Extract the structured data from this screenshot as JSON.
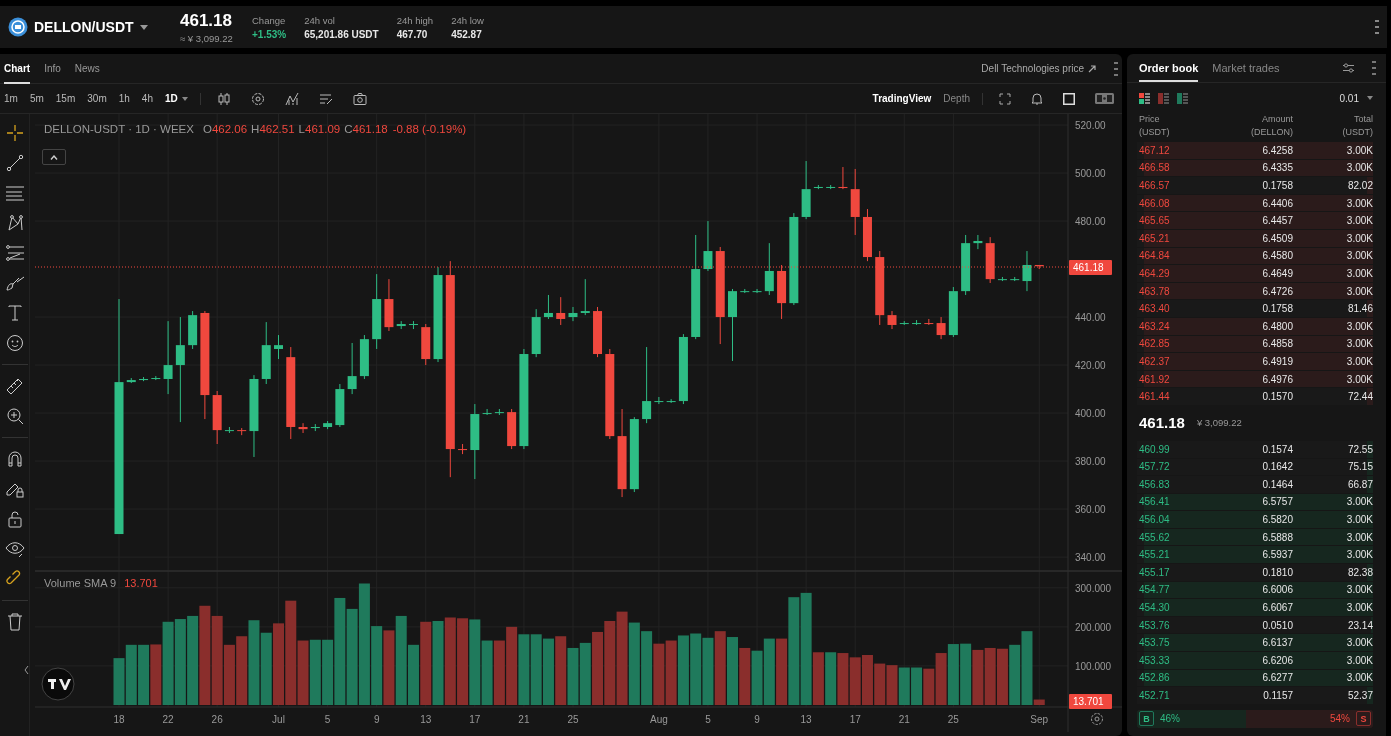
{
  "header": {
    "pair": "DELLON/USDT",
    "price": "461.18",
    "price_converted": "≈ ¥ 3,099.22",
    "stats": [
      {
        "label": "Change",
        "value": "+1.53%",
        "color": "#2ebd85"
      },
      {
        "label": "24h vol",
        "value": "65,201.86 USDT",
        "color": "#e8e8e8"
      },
      {
        "label": "24h high",
        "value": "467.70",
        "color": "#e8e8e8"
      },
      {
        "label": "24h low",
        "value": "452.87",
        "color": "#e8e8e8"
      }
    ]
  },
  "chart_tabs": [
    {
      "label": "Chart",
      "selected": true
    },
    {
      "label": "Info",
      "selected": false
    },
    {
      "label": "News",
      "selected": false
    }
  ],
  "external_link": "Dell Technologies price",
  "intervals": [
    {
      "label": "1m",
      "selected": false
    },
    {
      "label": "5m",
      "selected": false
    },
    {
      "label": "15m",
      "selected": false
    },
    {
      "label": "30m",
      "selected": false
    },
    {
      "label": "1h",
      "selected": false
    },
    {
      "label": "4h",
      "selected": false
    },
    {
      "label": "1D",
      "selected": true
    }
  ],
  "views": [
    {
      "label": "TradingView",
      "selected": true
    },
    {
      "label": "Depth",
      "selected": false
    }
  ],
  "legend": {
    "symbol": "DELLON-USDT · 1D · WEEX",
    "ohlc": [
      {
        "key": "O",
        "value": "462.06"
      },
      {
        "key": "H",
        "value": "462.51"
      },
      {
        "key": "L",
        "value": "461.09"
      },
      {
        "key": "C",
        "value": "461.18"
      }
    ],
    "change": "-0.88 (-0.19%)"
  },
  "price_chart": {
    "last_price_tag": "461.18",
    "chart_data": {
      "type": "candlestick",
      "grid": true,
      "ylim": [
        334.2,
        524.6
      ],
      "yticks": [
        {
          "value": 520,
          "label": "520.00"
        },
        {
          "value": 500,
          "label": "500.00"
        },
        {
          "value": 480,
          "label": "480.00"
        },
        {
          "value": 440,
          "label": "440.00"
        },
        {
          "value": 420,
          "label": "420.00"
        },
        {
          "value": 400,
          "label": "400.00"
        },
        {
          "value": 380,
          "label": "380.00"
        },
        {
          "value": 360,
          "label": "360.00"
        },
        {
          "value": 340,
          "label": "340.00"
        }
      ],
      "ohlc": [
        [
          349.6,
          447.5,
          349.6,
          412.9
        ],
        [
          412.9,
          414.6,
          412.5,
          413.75
        ],
        [
          413.75,
          415,
          413.3,
          414.2
        ],
        [
          414.2,
          415.4,
          413.75,
          414.6
        ],
        [
          414.2,
          438.3,
          407.9,
          420
        ],
        [
          420,
          440,
          396.25,
          428.3
        ],
        [
          428.3,
          442.5,
          426.7,
          440.8
        ],
        [
          441.7,
          442.5,
          397.5,
          407.5
        ],
        [
          407.5,
          409.2,
          387.1,
          392.9
        ],
        [
          392.9,
          394.2,
          391.7,
          392.9
        ],
        [
          392.9,
          393.75,
          390.8,
          392.5
        ],
        [
          392.5,
          415.8,
          381.7,
          414.2
        ],
        [
          414.2,
          437.9,
          412.1,
          428.3
        ],
        [
          426.7,
          432.5,
          422.5,
          428.3
        ],
        [
          423.3,
          427.5,
          389.2,
          394.2
        ],
        [
          394.2,
          395.8,
          391.7,
          393.3
        ],
        [
          393.75,
          395.4,
          392.5,
          394.2
        ],
        [
          394.2,
          396.7,
          393.3,
          395.8
        ],
        [
          395,
          412.1,
          394.2,
          410
        ],
        [
          410,
          429.2,
          407.9,
          415.4
        ],
        [
          415.4,
          432.5,
          414.2,
          430.8
        ],
        [
          430.8,
          457.9,
          426.7,
          447.5
        ],
        [
          447.5,
          455.8,
          434.2,
          435.8
        ],
        [
          436.25,
          438.3,
          435,
          437.1
        ],
        [
          436.7,
          438.3,
          435,
          437.1
        ],
        [
          435.8,
          437.1,
          420,
          422.5
        ],
        [
          422.5,
          460.8,
          421.25,
          457.5
        ],
        [
          457.5,
          463.3,
          373.3,
          385
        ],
        [
          385,
          387.1,
          382.9,
          384.6
        ],
        [
          384.6,
          403.75,
          372.5,
          399.6
        ],
        [
          400,
          401.7,
          399.2,
          400
        ],
        [
          400.4,
          401.7,
          399.2,
          400.4
        ],
        [
          400.4,
          401.7,
          385,
          386.25
        ],
        [
          386.25,
          426.7,
          385,
          424.6
        ],
        [
          424.6,
          443.3,
          423.3,
          440
        ],
        [
          440,
          449.2,
          439.2,
          441.7
        ],
        [
          441.7,
          448.3,
          436.7,
          439.2
        ],
        [
          440,
          444.2,
          438.3,
          441.7
        ],
        [
          441.7,
          455.8,
          440.8,
          442.5
        ],
        [
          442.5,
          444.2,
          423.3,
          424.6
        ],
        [
          424.6,
          426.7,
          389.2,
          390.4
        ],
        [
          390.4,
          401.7,
          365,
          368.3
        ],
        [
          368.3,
          398.3,
          367.1,
          397.5
        ],
        [
          397.5,
          427.5,
          395.8,
          405
        ],
        [
          405,
          406.7,
          403.75,
          405
        ],
        [
          405,
          405.8,
          404.2,
          405
        ],
        [
          405,
          432.9,
          403.75,
          431.7
        ],
        [
          431.7,
          474.2,
          430.8,
          460
        ],
        [
          460,
          480,
          459.2,
          467.5
        ],
        [
          467.5,
          469.2,
          428.75,
          440
        ],
        [
          440,
          451.7,
          421.7,
          450.8
        ],
        [
          450.8,
          451.7,
          450,
          450.8
        ],
        [
          450.8,
          451.7,
          450,
          450.8
        ],
        [
          450.8,
          470.8,
          449.2,
          459.2
        ],
        [
          459.2,
          461.7,
          439.2,
          445.8
        ],
        [
          445.8,
          483.3,
          445,
          481.7
        ],
        [
          481.7,
          505,
          480.8,
          493.3
        ],
        [
          494.2,
          495,
          493.3,
          494.2
        ],
        [
          494.2,
          495,
          493.3,
          494.2
        ],
        [
          494.2,
          502.5,
          493.3,
          493.75
        ],
        [
          493.3,
          501.7,
          474.2,
          481.7
        ],
        [
          481.7,
          485,
          463.3,
          465
        ],
        [
          465,
          467.5,
          436.7,
          440.8
        ],
        [
          440.8,
          442.5,
          435,
          436.7
        ],
        [
          437.5,
          438.3,
          436.7,
          437.5
        ],
        [
          437.5,
          438.75,
          436.7,
          437.5
        ],
        [
          437.5,
          439.2,
          436.7,
          437.1
        ],
        [
          437.5,
          440,
          430.8,
          432.5
        ],
        [
          432.5,
          452.5,
          431.7,
          450.8
        ],
        [
          450.8,
          474.2,
          449.2,
          470.8
        ],
        [
          470.8,
          474.2,
          468.3,
          471.7
        ],
        [
          470.8,
          473.3,
          454.2,
          455.8
        ],
        [
          455.8,
          456.7,
          455,
          455.8
        ],
        [
          455.8,
          456.7,
          455,
          455.8
        ],
        [
          455,
          467.5,
          450.8,
          461.7
        ],
        [
          461.7,
          461.7,
          460,
          461.18
        ]
      ]
    }
  },
  "volume": {
    "title": "Volume SMA 9",
    "sma": "13.701",
    "last_tag": "13.701",
    "chart_data": {
      "type": "bar",
      "stacked": true,
      "grid": true,
      "ylim": [
        0,
        343
      ],
      "categories": [
        "18",
        null,
        null,
        null,
        "22",
        null,
        null,
        null,
        "26",
        null,
        null,
        null,
        null,
        "Jul",
        null,
        null,
        null,
        "5",
        null,
        null,
        null,
        "9",
        null,
        null,
        null,
        "13",
        null,
        null,
        null,
        "17",
        null,
        null,
        null,
        "21",
        null,
        null,
        null,
        "25",
        null,
        null,
        null,
        null,
        null,
        null,
        "Aug",
        null,
        null,
        null,
        "5",
        null,
        null,
        null,
        "9",
        null,
        null,
        null,
        "13",
        null,
        null,
        null,
        "17",
        null,
        null,
        null,
        "21",
        null,
        null,
        null,
        "25",
        null,
        null,
        null,
        null,
        null,
        null,
        "Sep"
      ],
      "yticks": [
        {
          "value": 100,
          "label": "100.000"
        },
        {
          "value": 200,
          "label": "200.000"
        },
        {
          "value": 300,
          "label": "300.000"
        }
      ],
      "series": [
        {
          "color": "#1f7a5c",
          "values": [
            120,
            154,
            154,
            null,
            213,
            220,
            228,
            null,
            null,
            null,
            null,
            217,
            185,
            null,
            null,
            null,
            167,
            167,
            274,
            246,
            311,
            202,
            null,
            228,
            154,
            null,
            215,
            null,
            null,
            219,
            165,
            null,
            null,
            181,
            181,
            170,
            null,
            146,
            159,
            null,
            null,
            null,
            211,
            189,
            null,
            null,
            178,
            183,
            172,
            null,
            174,
            null,
            139,
            170,
            null,
            276,
            287,
            null,
            135,
            null,
            null,
            null,
            null,
            null,
            96,
            96,
            null,
            null,
            156,
            157,
            null,
            null,
            null,
            154,
            189,
            null
          ]
        },
        {
          "color": "#8a2e2c",
          "values": [
            null,
            null,
            null,
            155,
            null,
            null,
            null,
            254,
            228,
            154,
            176,
            null,
            null,
            209,
            267,
            165,
            null,
            null,
            null,
            null,
            null,
            null,
            191,
            null,
            null,
            213,
            null,
            224,
            222,
            null,
            null,
            165,
            200,
            null,
            null,
            null,
            176,
            null,
            null,
            187,
            215,
            239,
            null,
            null,
            157,
            165,
            null,
            null,
            null,
            189,
            null,
            146,
            null,
            null,
            170,
            null,
            null,
            135,
            null,
            133,
            122,
            128,
            106,
            102,
            null,
            null,
            93,
            133,
            null,
            null,
            141,
            146,
            144,
            null,
            null,
            14
          ]
        }
      ]
    }
  },
  "order_book": {
    "tabs": [
      {
        "label": "Order book",
        "selected": true
      },
      {
        "label": "Market trades",
        "selected": false
      }
    ],
    "precision": "0.01",
    "columns": [
      "Price\n(USDT)",
      "Amount\n(DELLON)",
      "Total\n(USDT)"
    ],
    "asks": [
      {
        "price": "467.12",
        "amount": "6.4258",
        "total": "3.00K",
        "level": 0.97
      },
      {
        "price": "466.58",
        "amount": "6.4335",
        "total": "3.00K",
        "level": 0.97
      },
      {
        "price": "466.57",
        "amount": "0.1758",
        "total": "82.02",
        "level": 0.025
      },
      {
        "price": "466.08",
        "amount": "6.4406",
        "total": "3.00K",
        "level": 0.97
      },
      {
        "price": "465.65",
        "amount": "6.4457",
        "total": "3.00K",
        "level": 0.97
      },
      {
        "price": "465.21",
        "amount": "6.4509",
        "total": "3.00K",
        "level": 0.97
      },
      {
        "price": "464.84",
        "amount": "6.4580",
        "total": "3.00K",
        "level": 0.97
      },
      {
        "price": "464.29",
        "amount": "6.4649",
        "total": "3.00K",
        "level": 0.97
      },
      {
        "price": "463.78",
        "amount": "6.4726",
        "total": "3.00K",
        "level": 0.97
      },
      {
        "price": "463.40",
        "amount": "0.1758",
        "total": "81.46",
        "level": 0.025
      },
      {
        "price": "463.24",
        "amount": "6.4800",
        "total": "3.00K",
        "level": 0.97
      },
      {
        "price": "462.85",
        "amount": "6.4858",
        "total": "3.00K",
        "level": 0.97
      },
      {
        "price": "462.37",
        "amount": "6.4919",
        "total": "3.00K",
        "level": 0.97
      },
      {
        "price": "461.92",
        "amount": "6.4976",
        "total": "3.00K",
        "level": 0.97
      },
      {
        "price": "461.44",
        "amount": "0.1570",
        "total": "72.44",
        "level": 0.025
      }
    ],
    "mid_price": "461.18",
    "mid_converted": "¥ 3,099.22",
    "bids": [
      {
        "price": "460.99",
        "amount": "0.1574",
        "total": "72.55",
        "level": 0.025
      },
      {
        "price": "457.72",
        "amount": "0.1642",
        "total": "75.15",
        "level": 0.025
      },
      {
        "price": "456.83",
        "amount": "0.1464",
        "total": "66.87",
        "level": 0.025
      },
      {
        "price": "456.41",
        "amount": "6.5757",
        "total": "3.00K",
        "level": 0.97
      },
      {
        "price": "456.04",
        "amount": "6.5820",
        "total": "3.00K",
        "level": 0.97
      },
      {
        "price": "455.62",
        "amount": "6.5888",
        "total": "3.00K",
        "level": 0.97
      },
      {
        "price": "455.21",
        "amount": "6.5937",
        "total": "3.00K",
        "level": 0.97
      },
      {
        "price": "455.17",
        "amount": "0.1810",
        "total": "82.38",
        "level": 0.025
      },
      {
        "price": "454.77",
        "amount": "6.6006",
        "total": "3.00K",
        "level": 0.97
      },
      {
        "price": "454.30",
        "amount": "6.6067",
        "total": "3.00K",
        "level": 0.97
      },
      {
        "price": "453.76",
        "amount": "0.0510",
        "total": "23.14",
        "level": 0.01
      },
      {
        "price": "453.75",
        "amount": "6.6137",
        "total": "3.00K",
        "level": 0.97
      },
      {
        "price": "453.33",
        "amount": "6.6206",
        "total": "3.00K",
        "level": 0.97
      },
      {
        "price": "452.86",
        "amount": "6.6277",
        "total": "3.00K",
        "level": 0.97
      },
      {
        "price": "452.71",
        "amount": "0.1157",
        "total": "52.37",
        "level": 0.025
      }
    ],
    "ratio": {
      "buy_label": "B",
      "buy": "46%",
      "sell": "54%",
      "sell_label": "S",
      "level": 0.46
    }
  }
}
